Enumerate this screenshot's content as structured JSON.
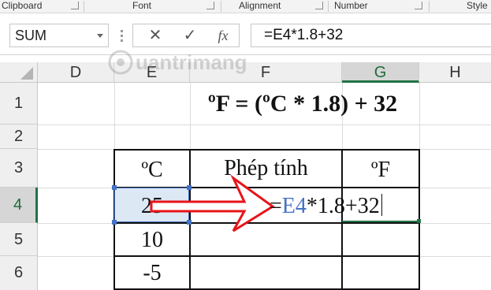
{
  "ribbon": {
    "groups": [
      "Clipboard",
      "Font",
      "Alignment",
      "Number",
      "Style"
    ]
  },
  "formula_bar": {
    "name_box": "SUM",
    "cancel_icon": "✕",
    "enter_icon": "✓",
    "fx_icon": "fx",
    "formula": "=E4*1.8+32"
  },
  "columns": [
    "D",
    "E",
    "F",
    "G",
    "H"
  ],
  "rows": [
    "1",
    "2",
    "3",
    "4",
    "5",
    "6"
  ],
  "sheet": {
    "title": "ºF = (ºC * 1.8) + 32",
    "header_c": "ºC",
    "header_calc": "Phép tính",
    "header_f": "ºF",
    "e4": "25",
    "e5": "10",
    "e6": "-5",
    "edit_eq": "=",
    "edit_ref": "E4",
    "edit_rest": "*1.8+32"
  },
  "watermark": "uantrimang",
  "colors": {
    "accent": "#217346",
    "reference_blue": "#4472c4",
    "arrow_red": "#e8141a"
  }
}
